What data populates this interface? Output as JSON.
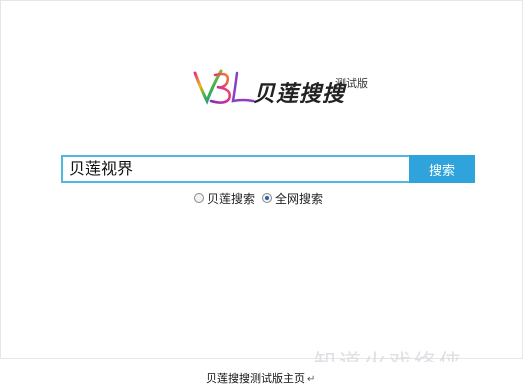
{
  "logo": {
    "mark": "VBL",
    "title": "贝莲搜搜",
    "subtitle": "测试版"
  },
  "search": {
    "query": "贝莲视界",
    "button_label": "搜索"
  },
  "scope_options": [
    {
      "label": "贝莲搜索",
      "selected": false
    },
    {
      "label": "全网搜索",
      "selected": true
    }
  ],
  "caption": {
    "text": "贝莲搜搜测试版主页",
    "mark": "↵"
  },
  "watermark": {
    "text": "知道火戏络侠"
  },
  "colors": {
    "accent": "#2fa3dc",
    "input_border": "#52b7e1"
  }
}
